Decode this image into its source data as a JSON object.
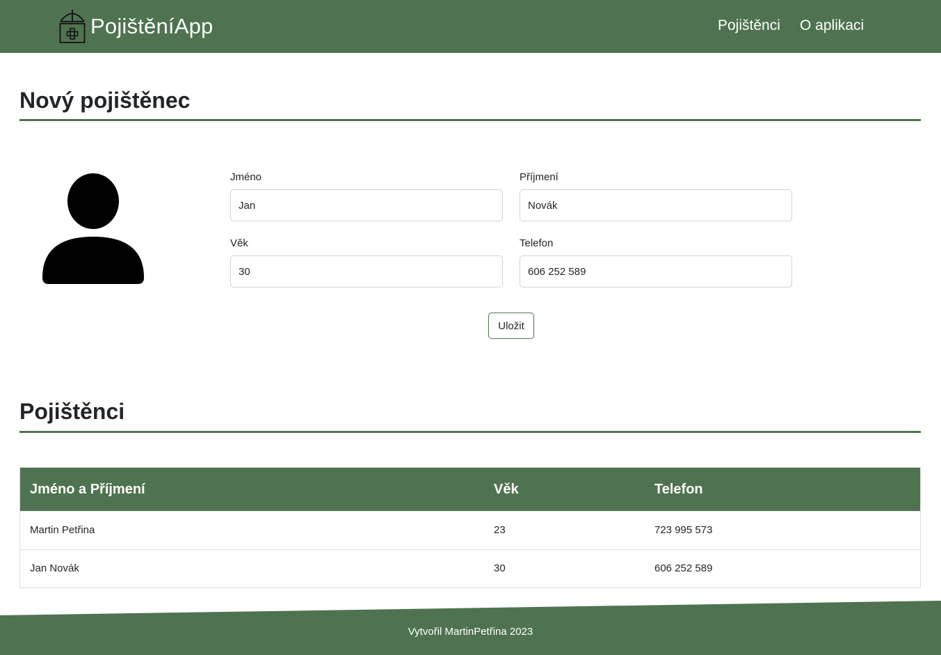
{
  "navbar": {
    "brand": "PojištěníApp",
    "links": [
      {
        "label": "Pojištěnci"
      },
      {
        "label": "O aplikaci"
      }
    ]
  },
  "form_section": {
    "title": "Nový pojištěnec",
    "fields": {
      "first_name": {
        "label": "Jméno",
        "value": "Jan"
      },
      "last_name": {
        "label": "Příjmení",
        "value": "Novák"
      },
      "age": {
        "label": "Věk",
        "value": "30"
      },
      "phone": {
        "label": "Telefon",
        "value": "606 252 589"
      }
    },
    "save_label": "Uložit"
  },
  "list_section": {
    "title": "Pojištěnci",
    "columns": [
      "Jméno a Příjmení",
      "Věk",
      "Telefon"
    ],
    "rows": [
      [
        "Martin Petřina",
        "23",
        "723 995 573"
      ],
      [
        "Jan Novák",
        "30",
        "606 252 589"
      ]
    ]
  },
  "footer": {
    "text": "Vytvořil MartinPetřina 2023"
  },
  "colors": {
    "brand_green": "#4f7350"
  },
  "icons": {
    "brand": "umbrella-medical-case-icon",
    "avatar": "person-silhouette-icon"
  }
}
